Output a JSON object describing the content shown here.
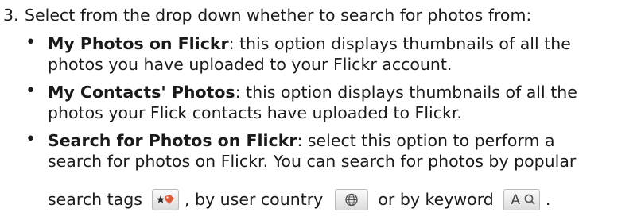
{
  "step": {
    "number": "3.",
    "text": "Select from the drop down whether to search for photos from:"
  },
  "bullets": [
    {
      "term": "My Photos on Flickr",
      "line1_rest": ": this option displays thumbnails of all the",
      "line2": "photos you have uploaded to your Flickr account."
    },
    {
      "term": "My Contacts' Photos",
      "line1_rest": ": this option displays thumbnails of all the",
      "line2": "photos your Flick contacts have uploaded to Flickr."
    },
    {
      "term": "Search for Photos on Flickr",
      "line1_rest": ": select this option to perform a",
      "line2": "search for photos on Flickr. You can search for photos by popular",
      "line3_a": "search tags",
      "line3_b": ", by user country",
      "line3_c": "or by keyword",
      "line3_d": "."
    }
  ],
  "icons": {
    "tags_button": "star-tag-icon",
    "country_button": "globe-icon",
    "keyword_button": "keyword-search-icon",
    "keyword_label": "A"
  }
}
